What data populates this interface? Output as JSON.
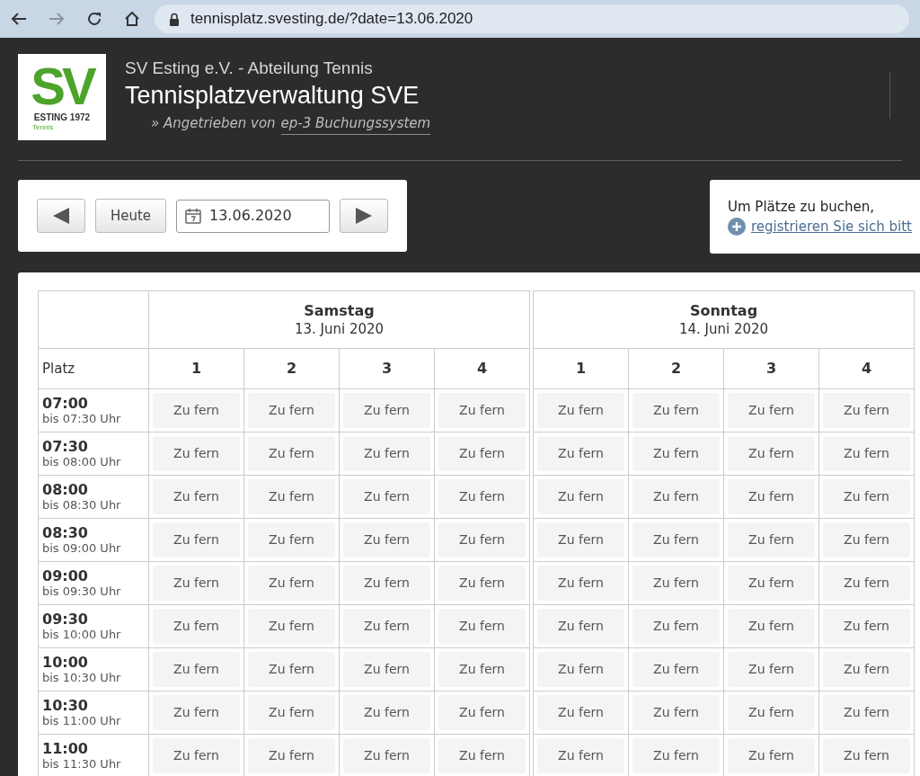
{
  "browser": {
    "url": "tennisplatz.svesting.de/?date=13.06.2020"
  },
  "header": {
    "logo": {
      "letters": "SV",
      "caption": "ESTING 1972",
      "sub": "Tennis"
    },
    "club": "SV Esting e.V. - Abteilung Tennis",
    "title": "Tennisplatzverwaltung SVE",
    "powered_prefix": "» Angetrieben von",
    "powered_link": "ep-3 Buchungssystem"
  },
  "nav": {
    "today_button": "Heute",
    "date_value": "13.06.2020"
  },
  "info": {
    "text": "Um Plätze zu buchen,",
    "link": "registrieren Sie sich bitt"
  },
  "table": {
    "corner_label": "Platz",
    "days": [
      {
        "weekday": "Samstag",
        "date": "13. Juni 2020",
        "courts": [
          "1",
          "2",
          "3",
          "4"
        ]
      },
      {
        "weekday": "Sonntag",
        "date": "14. Juni 2020",
        "courts": [
          "1",
          "2",
          "3",
          "4"
        ]
      }
    ],
    "rows": [
      {
        "start": "07:00",
        "end": "bis 07:30 Uhr",
        "slots": [
          "Zu fern",
          "Zu fern",
          "Zu fern",
          "Zu fern",
          "Zu fern",
          "Zu fern",
          "Zu fern",
          "Zu fern"
        ]
      },
      {
        "start": "07:30",
        "end": "bis 08:00 Uhr",
        "slots": [
          "Zu fern",
          "Zu fern",
          "Zu fern",
          "Zu fern",
          "Zu fern",
          "Zu fern",
          "Zu fern",
          "Zu fern"
        ]
      },
      {
        "start": "08:00",
        "end": "bis 08:30 Uhr",
        "slots": [
          "Zu fern",
          "Zu fern",
          "Zu fern",
          "Zu fern",
          "Zu fern",
          "Zu fern",
          "Zu fern",
          "Zu fern"
        ]
      },
      {
        "start": "08:30",
        "end": "bis 09:00 Uhr",
        "slots": [
          "Zu fern",
          "Zu fern",
          "Zu fern",
          "Zu fern",
          "Zu fern",
          "Zu fern",
          "Zu fern",
          "Zu fern"
        ]
      },
      {
        "start": "09:00",
        "end": "bis 09:30 Uhr",
        "slots": [
          "Zu fern",
          "Zu fern",
          "Zu fern",
          "Zu fern",
          "Zu fern",
          "Zu fern",
          "Zu fern",
          "Zu fern"
        ]
      },
      {
        "start": "09:30",
        "end": "bis 10:00 Uhr",
        "slots": [
          "Zu fern",
          "Zu fern",
          "Zu fern",
          "Zu fern",
          "Zu fern",
          "Zu fern",
          "Zu fern",
          "Zu fern"
        ]
      },
      {
        "start": "10:00",
        "end": "bis 10:30 Uhr",
        "slots": [
          "Zu fern",
          "Zu fern",
          "Zu fern",
          "Zu fern",
          "Zu fern",
          "Zu fern",
          "Zu fern",
          "Zu fern"
        ]
      },
      {
        "start": "10:30",
        "end": "bis 11:00 Uhr",
        "slots": [
          "Zu fern",
          "Zu fern",
          "Zu fern",
          "Zu fern",
          "Zu fern",
          "Zu fern",
          "Zu fern",
          "Zu fern"
        ]
      },
      {
        "start": "11:00",
        "end": "bis 11:30 Uhr",
        "slots": [
          "Zu fern",
          "Zu fern",
          "Zu fern",
          "Zu fern",
          "Zu fern",
          "Zu fern",
          "Zu fern",
          "Zu fern"
        ]
      }
    ]
  }
}
